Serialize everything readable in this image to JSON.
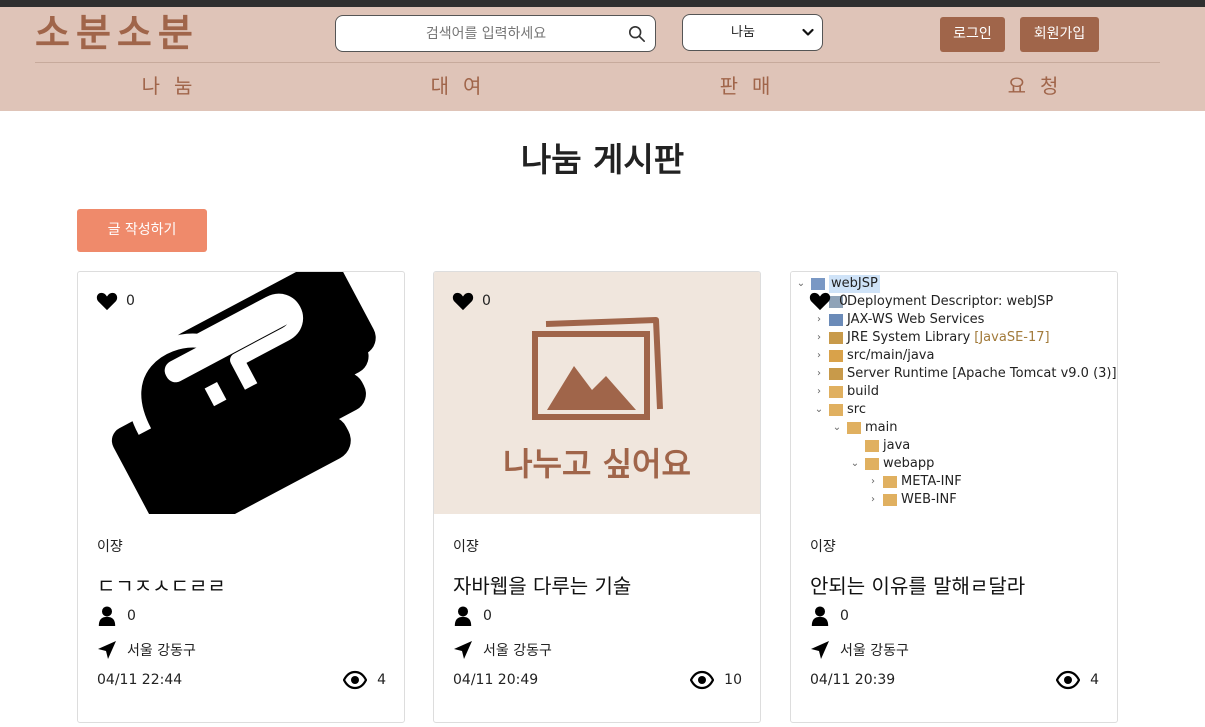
{
  "header": {
    "logo": "소분소분",
    "search_placeholder": "검색어를 입력하세요",
    "category_select": "나눔",
    "login_label": "로그인",
    "signup_label": "회원가입",
    "nav": [
      "나눔",
      "대여",
      "판매",
      "요청"
    ]
  },
  "page": {
    "title": "나눔 게시판",
    "write_button": "글 작성하기"
  },
  "cards": [
    {
      "likes": "0",
      "author": "이쟝",
      "title": "ㄷㄱㅈㅅㄷㄹㄹ",
      "participants": "0",
      "location": "서울 강동구",
      "date": "04/11 22:44",
      "views": "4",
      "image_icon": "handshake-icon"
    },
    {
      "likes": "0",
      "author": "이쟝",
      "title": "자바웹을 다루는 기술",
      "participants": "0",
      "location": "서울 강동구",
      "date": "04/11 20:49",
      "views": "10",
      "image_caption": "나누고 싶어요",
      "image_icon": "image-placeholder-icon"
    },
    {
      "likes": "0",
      "author": "이쟝",
      "title": "안되는 이유를 말해ㄹ달라",
      "participants": "0",
      "location": "서울 강동구",
      "date": "04/11 20:39",
      "views": "4",
      "tree": [
        "webJSP",
        "Deployment Descriptor: webJSP",
        "JAX-WS Web Services",
        "JRE System Library",
        "[JavaSE-17]",
        "src/main/java",
        "Server Runtime [Apache Tomcat v9.0 (3)]",
        "build",
        "src",
        "main",
        "java",
        "webapp",
        "META-INF",
        "WEB-INF"
      ]
    }
  ],
  "colors": {
    "header_bg": "#dfc4b8",
    "brand": "#a0654a",
    "write_button": "#ef8a6b",
    "placeholder_bg": "#f0e6dd"
  }
}
